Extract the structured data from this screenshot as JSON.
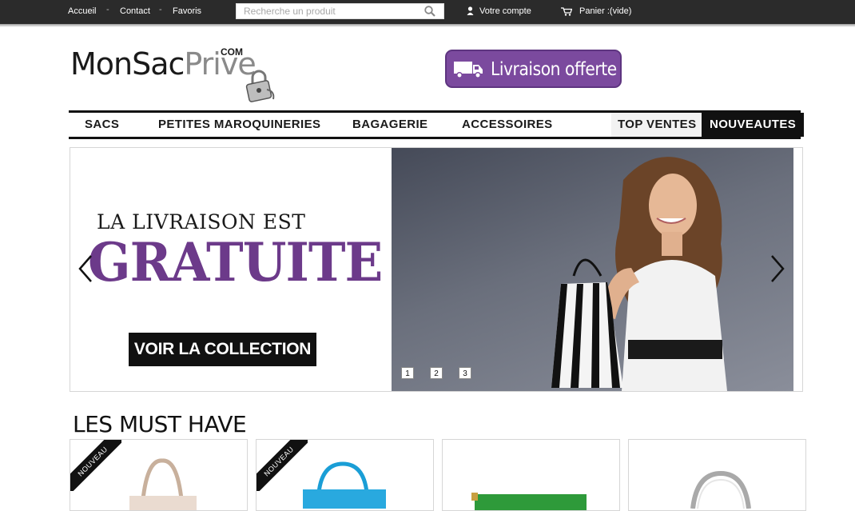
{
  "topbar": {
    "links": [
      "Accueil",
      "Contact",
      "Favoris"
    ],
    "separator": "-",
    "search_placeholder": "Recherche un produit",
    "account_label": "Votre compte",
    "cart_label": "Panier :(vide)"
  },
  "logo": {
    "main": "MonSac",
    "accent": "Prive",
    "suffix": "COM"
  },
  "delivery_banner": "Livraison offerte",
  "nav": {
    "items": [
      "SACS",
      "PETITES MAROQUINERIES",
      "BAGAGERIE",
      "ACCESSOIRES",
      "TOP VENTES",
      "NOUVEAUTES"
    ]
  },
  "slider": {
    "headline_top": "LA LIVRAISON EST",
    "headline_main": "GRATUITE",
    "cta": "VOIR LA COLLECTION",
    "pages": [
      "1",
      "2",
      "3"
    ]
  },
  "must_have": {
    "title": "LES MUST HAVE",
    "ribbon": "NOUVEAU"
  },
  "colors": {
    "topbar": "#2b2b2b",
    "purple": "#6c3a8a",
    "banner": "#7b4a9e",
    "black": "#111111"
  },
  "icons": [
    "search-icon",
    "user-icon",
    "cart-icon",
    "truck-icon",
    "padlock-icon",
    "chevron-left-icon",
    "chevron-right-icon"
  ]
}
